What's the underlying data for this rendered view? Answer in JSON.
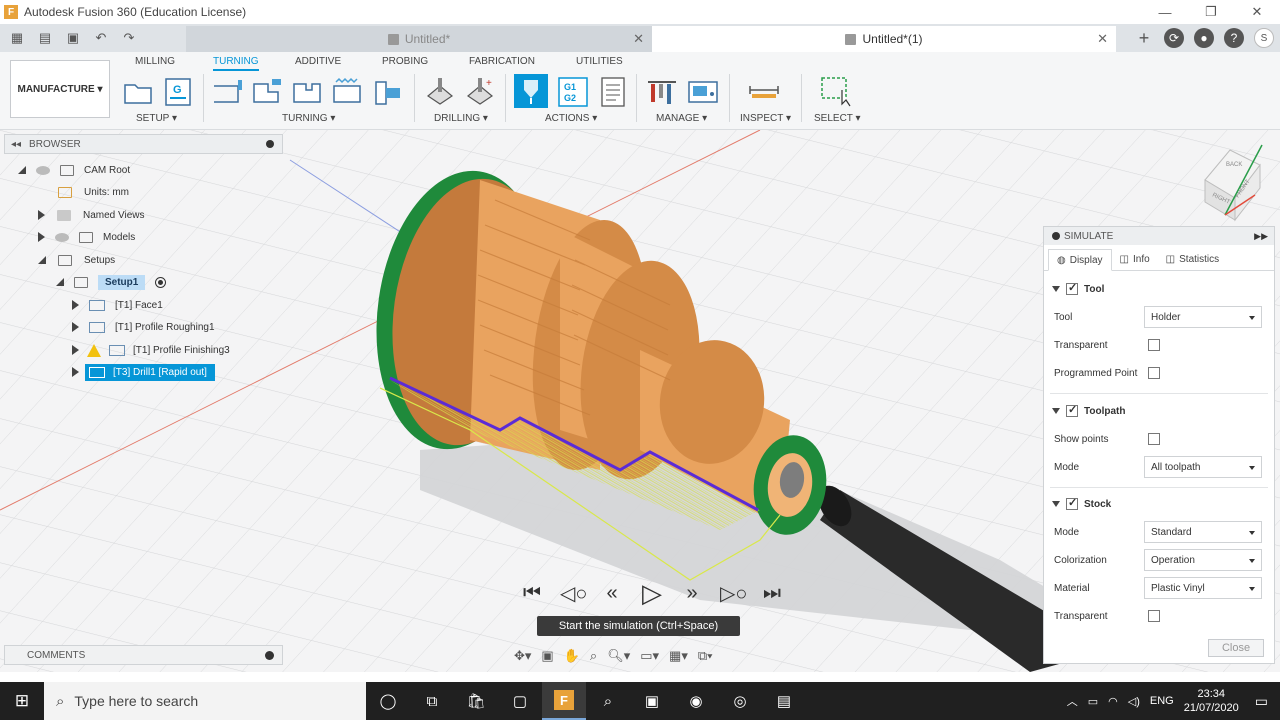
{
  "window": {
    "title": "Autodesk Fusion 360 (Education License)",
    "logo_letter": "F"
  },
  "tabs": [
    {
      "label": "Untitled*"
    },
    {
      "label": "Untitled*(1)"
    }
  ],
  "ribbon": {
    "workspace": "MANUFACTURE",
    "tabs": [
      "MILLING",
      "TURNING",
      "ADDITIVE",
      "PROBING",
      "FABRICATION",
      "UTILITIES"
    ],
    "active_tab": "TURNING",
    "groups": [
      "SETUP",
      "TURNING",
      "DRILLING",
      "ACTIONS",
      "MANAGE",
      "INSPECT",
      "SELECT"
    ]
  },
  "browser": {
    "title": "BROWSER",
    "items": [
      {
        "label": "CAM Root"
      },
      {
        "label": "Units: mm"
      },
      {
        "label": "Named Views"
      },
      {
        "label": "Models"
      },
      {
        "label": "Setups"
      },
      {
        "label": "Setup1"
      },
      {
        "label": "[T1] Face1"
      },
      {
        "label": "[T1] Profile Roughing1"
      },
      {
        "label": "[T1] Profile Finishing3"
      },
      {
        "label": "[T3] Drill1 [Rapid out]"
      }
    ]
  },
  "comments": {
    "title": "COMMENTS"
  },
  "simulate": {
    "title": "SIMULATE",
    "tabs": [
      "Display",
      "Info",
      "Statistics"
    ],
    "tool": {
      "section": "Tool",
      "tool_label": "Tool",
      "tool_value": "Holder",
      "transparent_label": "Transparent",
      "programmed_point_label": "Programmed Point"
    },
    "toolpath": {
      "section": "Toolpath",
      "show_points_label": "Show points",
      "mode_label": "Mode",
      "mode_value": "All toolpath"
    },
    "stock": {
      "section": "Stock",
      "mode_label": "Mode",
      "mode_value": "Standard",
      "colorization_label": "Colorization",
      "colorization_value": "Operation",
      "material_label": "Material",
      "material_value": "Plastic Vinyl",
      "transparent_label": "Transparent"
    },
    "close_label": "Close"
  },
  "playback": {
    "tooltip": "Start the simulation (Ctrl+Space)"
  },
  "viewcube": {
    "faces": [
      "RIGHT",
      "FRONT",
      "BACK"
    ]
  },
  "taskbar": {
    "search_placeholder": "Type here to search",
    "language": "ENG",
    "time": "23:34",
    "date": "21/07/2020"
  },
  "colors": {
    "accent": "#0696d7",
    "stock_orange": "#e9a35f",
    "green_rim": "#1f8a3b",
    "toolpath_purple": "#5b2bd6",
    "toolpath_yellow": "#d9e84a"
  }
}
